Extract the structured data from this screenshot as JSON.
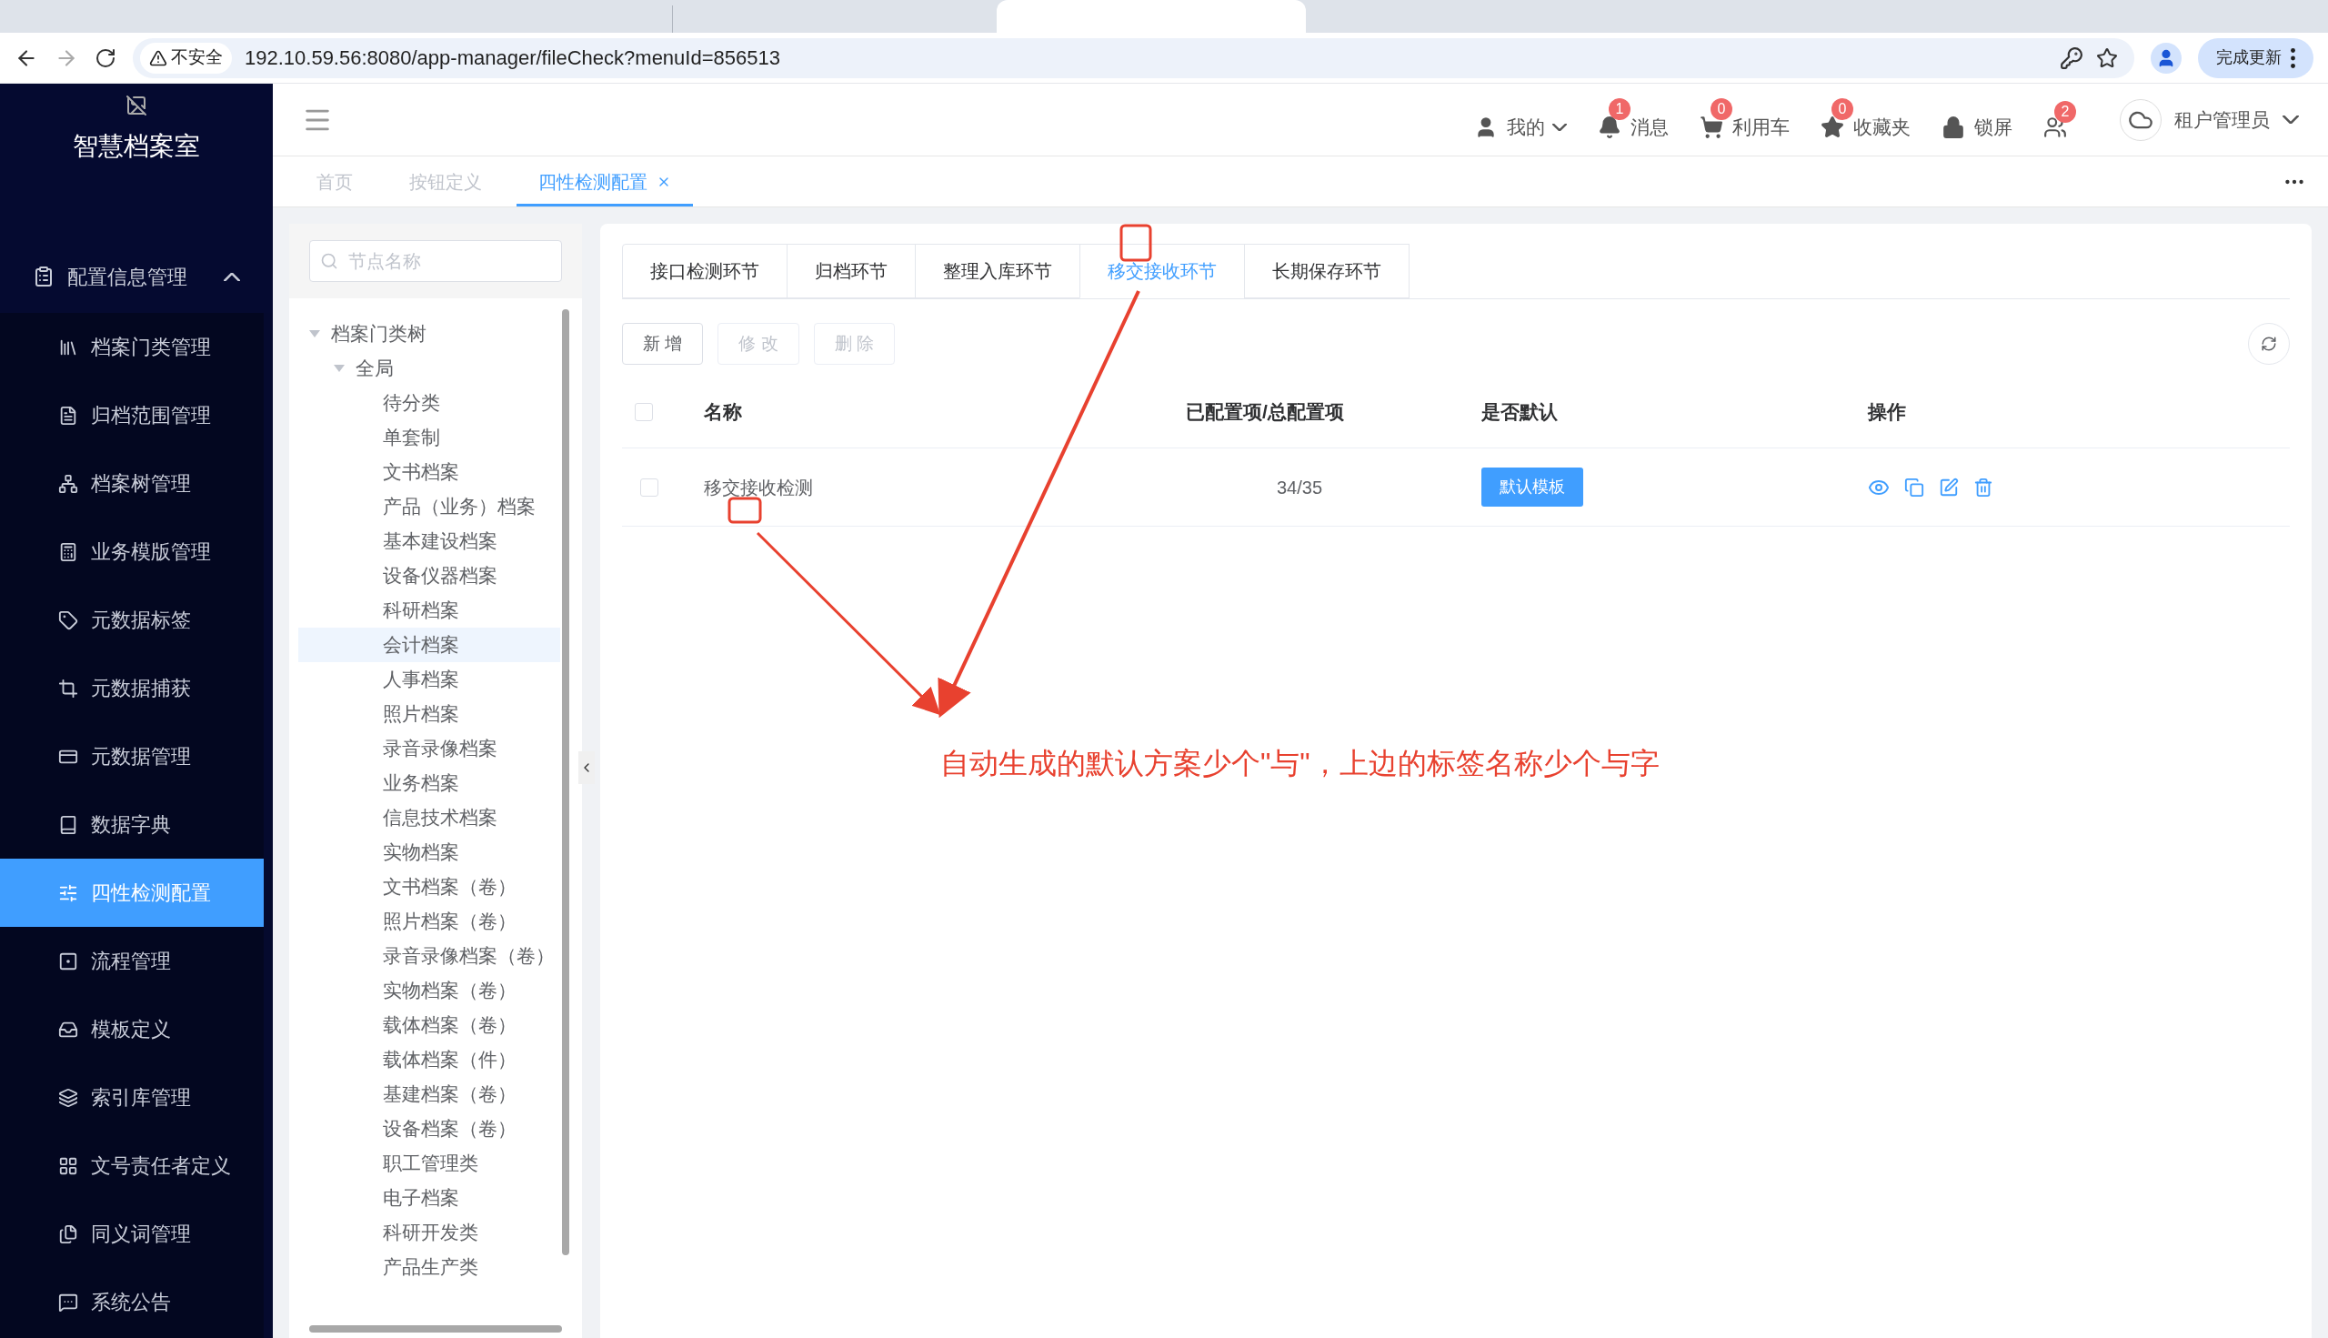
{
  "browser": {
    "security": "不安全",
    "address": "192.10.59.56:8080/app-manager/fileCheck?menuId=856513",
    "update_button": "完成更新"
  },
  "logo_title": "智慧档案室",
  "header_items": [
    {
      "kind": "user",
      "label": "我的"
    },
    {
      "kind": "bell",
      "label": "消息",
      "badge": "1"
    },
    {
      "kind": "cart",
      "label": "利用车",
      "badge": "0"
    },
    {
      "kind": "star",
      "label": "收藏夹",
      "badge": "0"
    },
    {
      "kind": "lock",
      "label": "锁屏"
    },
    {
      "kind": "users",
      "badge": "2"
    }
  ],
  "account": "租户管理员",
  "page_tabs": [
    {
      "label": "首页",
      "selected": false,
      "closable": false
    },
    {
      "label": "按钮定义",
      "selected": false,
      "closable": false
    },
    {
      "label": "四性检测配置",
      "selected": true,
      "closable": true
    }
  ],
  "sidebar": {
    "group": {
      "label": "配置信息管理",
      "expanded": true
    },
    "items": [
      {
        "label": "档案门类管理",
        "selected": false
      },
      {
        "label": "归档范围管理",
        "selected": false
      },
      {
        "label": "档案树管理",
        "selected": false
      },
      {
        "label": "业务模版管理",
        "selected": false
      },
      {
        "label": "元数据标签",
        "selected": false
      },
      {
        "label": "元数据捕获",
        "selected": false
      },
      {
        "label": "元数据管理",
        "selected": false
      },
      {
        "label": "数据字典",
        "selected": false
      },
      {
        "label": "四性检测配置",
        "selected": true
      },
      {
        "label": "流程管理",
        "selected": false
      },
      {
        "label": "模板定义",
        "selected": false
      },
      {
        "label": "索引库管理",
        "selected": false
      },
      {
        "label": "文号责任者定义",
        "selected": false
      },
      {
        "label": "同义词管理",
        "selected": false
      },
      {
        "label": "系统公告",
        "selected": false
      }
    ]
  },
  "tree": {
    "placeholder": "节点名称",
    "nodes": [
      {
        "label": "档案门类树",
        "selected": false,
        "expanded": true,
        "children": [
          {
            "label": "全局",
            "selected": false,
            "expanded": true,
            "children": [
              {
                "label": "待分类",
                "selected": false
              },
              {
                "label": "单套制",
                "selected": false
              },
              {
                "label": "文书档案",
                "selected": false
              },
              {
                "label": "产品（业务）档案",
                "selected": false
              },
              {
                "label": "基本建设档案",
                "selected": false
              },
              {
                "label": "设备仪器档案",
                "selected": false
              },
              {
                "label": "科研档案",
                "selected": false
              },
              {
                "label": "会计档案",
                "selected": true
              },
              {
                "label": "人事档案",
                "selected": false
              },
              {
                "label": "照片档案",
                "selected": false
              },
              {
                "label": "录音录像档案",
                "selected": false
              },
              {
                "label": "业务档案",
                "selected": false
              },
              {
                "label": "信息技术档案",
                "selected": false
              },
              {
                "label": "实物档案",
                "selected": false
              },
              {
                "label": "文书档案（卷）",
                "selected": false
              },
              {
                "label": "照片档案（卷）",
                "selected": false
              },
              {
                "label": "录音录像档案（卷）",
                "selected": false
              },
              {
                "label": "实物档案（卷）",
                "selected": false
              },
              {
                "label": "载体档案（卷）",
                "selected": false
              },
              {
                "label": "载体档案（件）",
                "selected": false
              },
              {
                "label": "基建档案（卷）",
                "selected": false
              },
              {
                "label": "设备档案（卷）",
                "selected": false
              },
              {
                "label": "职工管理类",
                "selected": false
              },
              {
                "label": "电子档案",
                "selected": false
              },
              {
                "label": "科研开发类",
                "selected": false
              },
              {
                "label": "产品生产类",
                "selected": false
              }
            ]
          }
        ]
      }
    ]
  },
  "section_tabs": [
    {
      "label": "接口检测环节",
      "selected": false
    },
    {
      "label": "归档环节",
      "selected": false
    },
    {
      "label": "整理入库环节",
      "selected": false
    },
    {
      "label": "移交接收环节",
      "selected": true
    },
    {
      "label": "长期保存环节",
      "selected": false
    }
  ],
  "toolbar": [
    {
      "label": "新 增",
      "disabled": false
    },
    {
      "label": "修 改",
      "disabled": true
    },
    {
      "label": "删 除",
      "disabled": true
    }
  ],
  "table": {
    "columns": [
      "名称",
      "已配置项/总配置项",
      "是否默认",
      "操作"
    ],
    "header_checked": false,
    "rows": [
      {
        "checked": false,
        "name": "移交接收检测",
        "count": "34/35",
        "default": "默认模板"
      }
    ]
  },
  "annotation": {
    "text": "自动生成的默认方案少个\"与\"，上边的标签名称少个与字"
  }
}
